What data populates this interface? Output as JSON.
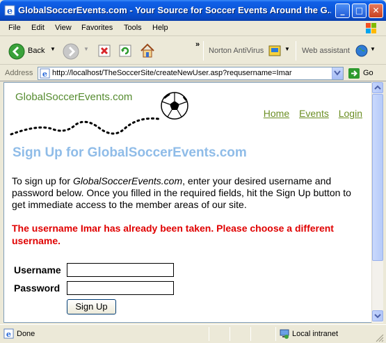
{
  "window": {
    "title": "GlobalSoccerEvents.com - Your Source for Soccer Events Around the G...",
    "minimize": "_",
    "maximize": "□",
    "close": "✕"
  },
  "menu": [
    "File",
    "Edit",
    "View",
    "Favorites",
    "Tools",
    "Help"
  ],
  "toolbar": {
    "back_label": "Back",
    "chevrons": "»",
    "norton_label": "Norton AntiVirus",
    "web_assistant_label": "Web assistant"
  },
  "address": {
    "label": "Address",
    "url": "http://localhost/TheSoccerSite/createNewUser.asp?requsername=Imar",
    "go_label": "Go"
  },
  "page": {
    "logo_text": "GlobalSoccerEvents.com",
    "nav": [
      "Home",
      "Events",
      "Login"
    ],
    "heading": "Sign Up for GlobalSoccerEvents.com",
    "intro_prefix": "To sign up for ",
    "intro_site": "GlobalSoccerEvents.com",
    "intro_suffix": ", enter your desired username and password below. Once you filled in the required fields, hit the Sign Up button to get immediate access to the member areas of our site.",
    "error": "The username Imar has already been taken. Please choose a different username.",
    "username_label": "Username",
    "password_label": "Password",
    "username_value": "",
    "password_value": "",
    "signup_button": "Sign Up"
  },
  "status": {
    "text": "Done",
    "zone": "Local intranet"
  },
  "colors": {
    "heading": "#8fbce8",
    "error": "#e00000",
    "nav_link": "#6b8e23",
    "logo": "#558b2f"
  }
}
